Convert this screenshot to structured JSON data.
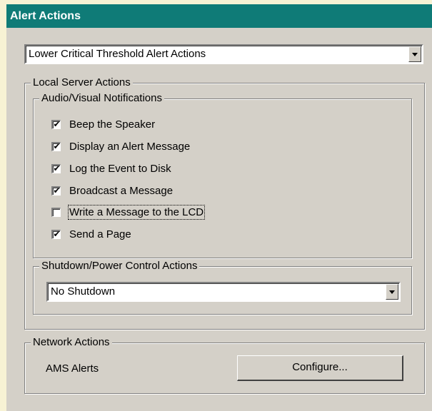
{
  "window": {
    "title": "Alert Actions"
  },
  "alert_type_select": {
    "value": "Lower Critical Threshold Alert Actions"
  },
  "local_server_actions": {
    "legend": "Local Server Actions",
    "audio_visual": {
      "legend": "Audio/Visual Notifications",
      "options": [
        {
          "label": "Beep the Speaker",
          "checked": true
        },
        {
          "label": "Display an Alert Message",
          "checked": true
        },
        {
          "label": "Log the Event to Disk",
          "checked": true
        },
        {
          "label": "Broadcast a Message",
          "checked": true
        },
        {
          "label": "Write a Message to the LCD",
          "checked": false
        },
        {
          "label": "Send a Page",
          "checked": true
        }
      ]
    },
    "shutdown": {
      "legend": "Shutdown/Power Control Actions",
      "select_value": "No Shutdown"
    }
  },
  "network_actions": {
    "legend": "Network Actions",
    "ams_label": "AMS Alerts",
    "configure_label": "Configure..."
  }
}
